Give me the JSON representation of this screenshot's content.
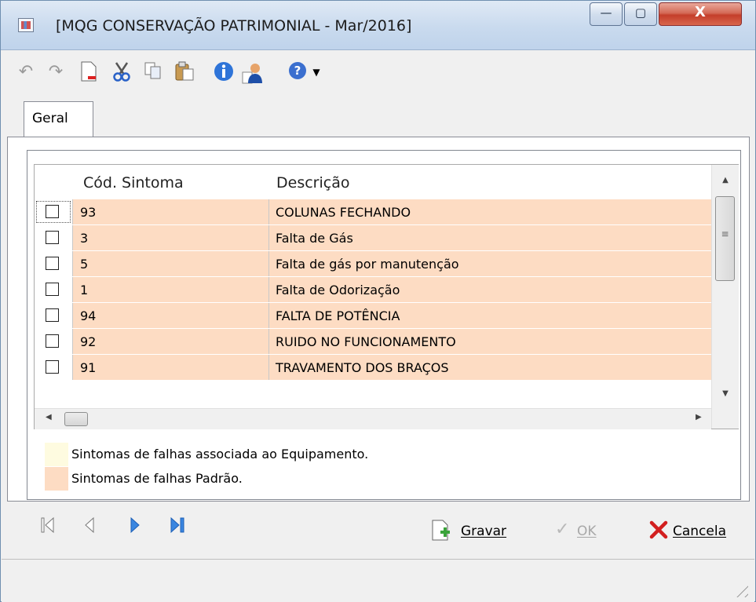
{
  "window": {
    "title": "[MQG CONSERVAÇÃO PATRIMONIAL - Mar/2016]",
    "controls": {
      "minimize": "—",
      "maximize": "▢",
      "close": "X"
    }
  },
  "toolbar": {
    "icons": [
      "import-icon",
      "export-icon",
      "new-document-icon",
      "cut-icon",
      "copy-icon",
      "paste-icon",
      "info-icon",
      "user-icon",
      "help-icon",
      "dropdown-arrow-icon"
    ]
  },
  "tabs": [
    {
      "label": "Geral",
      "active": true
    }
  ],
  "grid": {
    "columns": {
      "code": "Cód. Sintoma",
      "description": "Descrição"
    },
    "rows": [
      {
        "code": "93",
        "description": "COLUNAS FECHANDO",
        "checked": false
      },
      {
        "code": "3",
        "description": "Falta de Gás",
        "checked": false
      },
      {
        "code": "5",
        "description": "Falta de gás por manutenção",
        "checked": false
      },
      {
        "code": "1",
        "description": "Falta de Odorização",
        "checked": false
      },
      {
        "code": "94",
        "description": "FALTA DE POTÊNCIA",
        "checked": false
      },
      {
        "code": "92",
        "description": "RUIDO NO FUNCIONAMENTO",
        "checked": false
      },
      {
        "code": "91",
        "description": "TRAVAMENTO DOS BRAÇOS",
        "checked": false
      }
    ]
  },
  "legend": [
    {
      "label": "Sintomas de falhas associada ao Equipamento.",
      "color": "#fefbe0"
    },
    {
      "label": "Sintomas de falhas Padrão.",
      "color": "#fddcc3"
    }
  ],
  "navigation": {
    "first": "first-record-icon",
    "previous": "previous-record-icon",
    "next": "next-record-icon",
    "last": "last-record-icon"
  },
  "buttons": {
    "save": "Gravar",
    "ok": "OK",
    "cancel": "Cancela"
  },
  "colors": {
    "row_default": "#fddcc3",
    "row_equipment": "#fefbe0",
    "accent_blue": "#2e74d8",
    "cancel_red": "#d21f1f",
    "save_green": "#3aa33a"
  }
}
